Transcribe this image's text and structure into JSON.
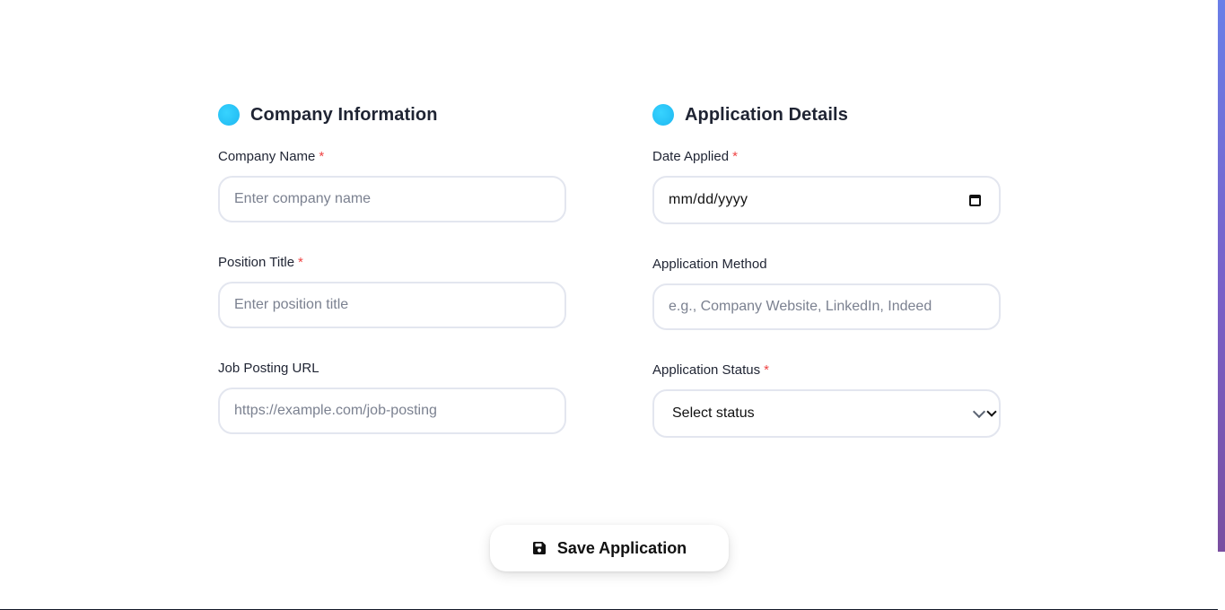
{
  "form": {
    "company_section": {
      "title": "Company Information",
      "company_name_label": "Company Name",
      "company_name_placeholder": "Enter company name",
      "position_title_label": "Position Title",
      "position_title_placeholder": "Enter position title",
      "job_url_label": "Job Posting URL",
      "job_url_placeholder": "https://example.com/job-posting"
    },
    "application_section": {
      "title": "Application Details",
      "date_applied_label": "Date Applied",
      "date_applied_value": "mm/dd/yyyy",
      "method_label": "Application Method",
      "method_placeholder": "e.g., Company Website, LinkedIn, Indeed",
      "status_label": "Application Status",
      "status_selected": "Select status"
    },
    "required_marker": "*",
    "save_button_label": "Save Application"
  },
  "icons": {
    "section": "dot-icon",
    "calendar": "calendar-icon",
    "dropdown": "chevron-down-icon",
    "save": "save-icon"
  },
  "colors": {
    "accent_dot": "#26c0f5",
    "required": "#ef4444",
    "input_border": "#e3e6ef",
    "scrollbar": "#7a5fc6"
  }
}
